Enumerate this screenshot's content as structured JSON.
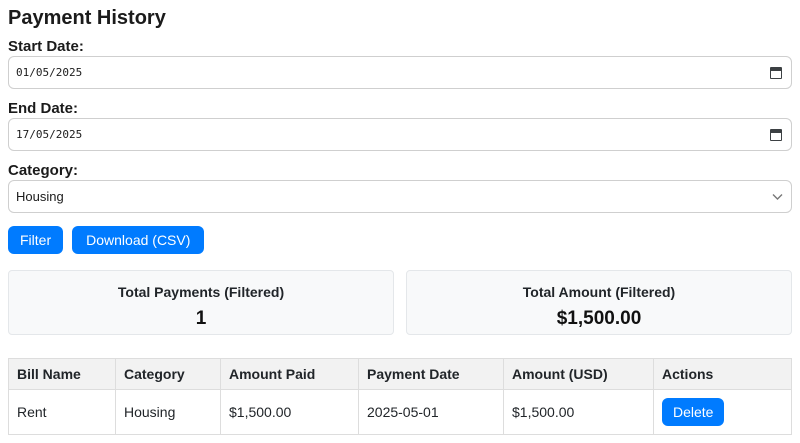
{
  "page": {
    "title": "Payment History"
  },
  "filters": {
    "start_date": {
      "label": "Start Date:",
      "value": "01/05/2025"
    },
    "end_date": {
      "label": "End Date:",
      "value": "17/05/2025"
    },
    "category": {
      "label": "Category:",
      "value": "Housing"
    }
  },
  "actions": {
    "filter_label": "Filter",
    "download_label": "Download (CSV)"
  },
  "summary_cards": [
    {
      "label": "Total Payments (Filtered)",
      "value": "1"
    },
    {
      "label": "Total Amount (Filtered)",
      "value": "$1,500.00"
    }
  ],
  "payments_table": {
    "headers": [
      "Bill Name",
      "Category",
      "Amount Paid",
      "Payment Date",
      "Amount (USD)",
      "Actions"
    ],
    "rows": [
      {
        "bill_name": "Rent",
        "category": "Housing",
        "amount_paid": "$1,500.00",
        "payment_date": "2025-05-01",
        "amount_usd": "$1,500.00",
        "delete_label": "Delete"
      }
    ]
  },
  "icons": {
    "calendar": "calendar-icon",
    "select_chevron": "chevron-down-icon"
  },
  "colors": {
    "primary_button": "#007bff",
    "card_background": "#f8f9fa",
    "table_header_background": "#f2f2f2",
    "border": "#dddddd"
  }
}
